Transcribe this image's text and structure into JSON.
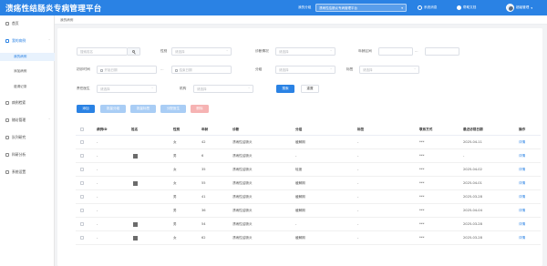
{
  "header": {
    "title": "溃疡性结肠炎专病管理平台",
    "org_label": "我的分组",
    "org_value": "溃疡性结肠炎专病管理平台",
    "message_label": "系统消息",
    "help_label": "帮助文档",
    "user_name": "超级管理"
  },
  "sidebar": {
    "items": [
      {
        "label": "首页"
      },
      {
        "label": "我的病例"
      },
      {
        "label": "病例检索"
      },
      {
        "label": "随访管理"
      },
      {
        "label": "队列研究"
      },
      {
        "label": "科研分析"
      },
      {
        "label": "系统设置"
      }
    ],
    "sub_items": [
      {
        "label": "我的病例"
      },
      {
        "label": "添加病例"
      },
      {
        "label": "邀请记录"
      }
    ]
  },
  "breadcrumb": "我的病例",
  "filters": {
    "keyword_placeholder": "搜索姓名",
    "gender_label": "性别",
    "gender_placeholder": "请选择",
    "diagnosis_label": "诊断情况",
    "diagnosis_placeholder": "请选择",
    "age_label": "年龄区间",
    "visit_time_label": "初诊时间",
    "start_placeholder": "开始日期",
    "end_placeholder": "结束日期",
    "type_label": "分组",
    "type_placeholder": "请选择",
    "tag_label": "标签",
    "tag_placeholder": "请选择",
    "doctor_label": "责任医生",
    "doctor_placeholder": "请选择",
    "org_label": "机构",
    "org_placeholder": "请选择",
    "search_label": "搜索",
    "reset_label": "重置",
    "range_sep": "—",
    "ellipsis": "..."
  },
  "actions": {
    "add": "添加",
    "batch_group": "批量分组",
    "batch_tag": "批量标签",
    "assign": "分配医生",
    "delete": "删除"
  },
  "table": {
    "columns": [
      "病例ID",
      "姓名",
      "性别",
      "年龄",
      "诊断",
      "分组",
      "标签",
      "联系方式",
      "最近访视日期",
      "操作"
    ],
    "rows": [
      {
        "id": "-",
        "gender": "女",
        "age": "42",
        "diagnosis": "溃疡性结肠炎",
        "group": "缓解期",
        "tag": "-",
        "phone": "***",
        "date": "2025-04-11",
        "op": "详情",
        "photo": false
      },
      {
        "id": "-",
        "gender": "男",
        "age": "6",
        "diagnosis": "溃疡性结肠炎",
        "group": "-",
        "tag": "-",
        "phone": "***",
        "date": "-",
        "op": "详情",
        "photo": true
      },
      {
        "id": "-",
        "gender": "女",
        "age": "35",
        "diagnosis": "溃疡性结肠炎",
        "group": "轻度",
        "tag": "-",
        "phone": "***",
        "date": "2025-04-02",
        "op": "详情",
        "photo": false
      },
      {
        "id": "-",
        "gender": "女",
        "age": "55",
        "diagnosis": "溃疡性结肠炎",
        "group": "缓解期",
        "tag": "-",
        "phone": "***",
        "date": "2025-04-01",
        "op": "详情",
        "photo": true
      },
      {
        "id": "-",
        "gender": "男",
        "age": "41",
        "diagnosis": "溃疡性结肠炎",
        "group": "缓解期",
        "tag": "-",
        "phone": "***",
        "date": "2025-03-28",
        "op": "详情",
        "photo": false
      },
      {
        "id": "-",
        "gender": "男",
        "age": "36",
        "diagnosis": "溃疡性结肠炎",
        "group": "缓解期",
        "tag": "-",
        "phone": "***",
        "date": "2025-04-04",
        "op": "详情",
        "photo": false
      },
      {
        "id": "-",
        "gender": "男",
        "age": "54",
        "diagnosis": "溃疡性结肠炎",
        "group": "-",
        "tag": "-",
        "phone": "***",
        "date": "2025-03-28",
        "op": "详情",
        "photo": true
      },
      {
        "id": "-",
        "gender": "女",
        "age": "62",
        "diagnosis": "溃疡性结肠炎",
        "group": "缓解期",
        "tag": "-",
        "phone": "***",
        "date": "2025-03-28",
        "op": "详情",
        "photo": true
      }
    ]
  },
  "colors": {
    "primary": "#2a82e4",
    "primary_light": "#a9cdf5",
    "danger_light": "#f6b3b3",
    "active_bg": "#e8f2fd"
  }
}
